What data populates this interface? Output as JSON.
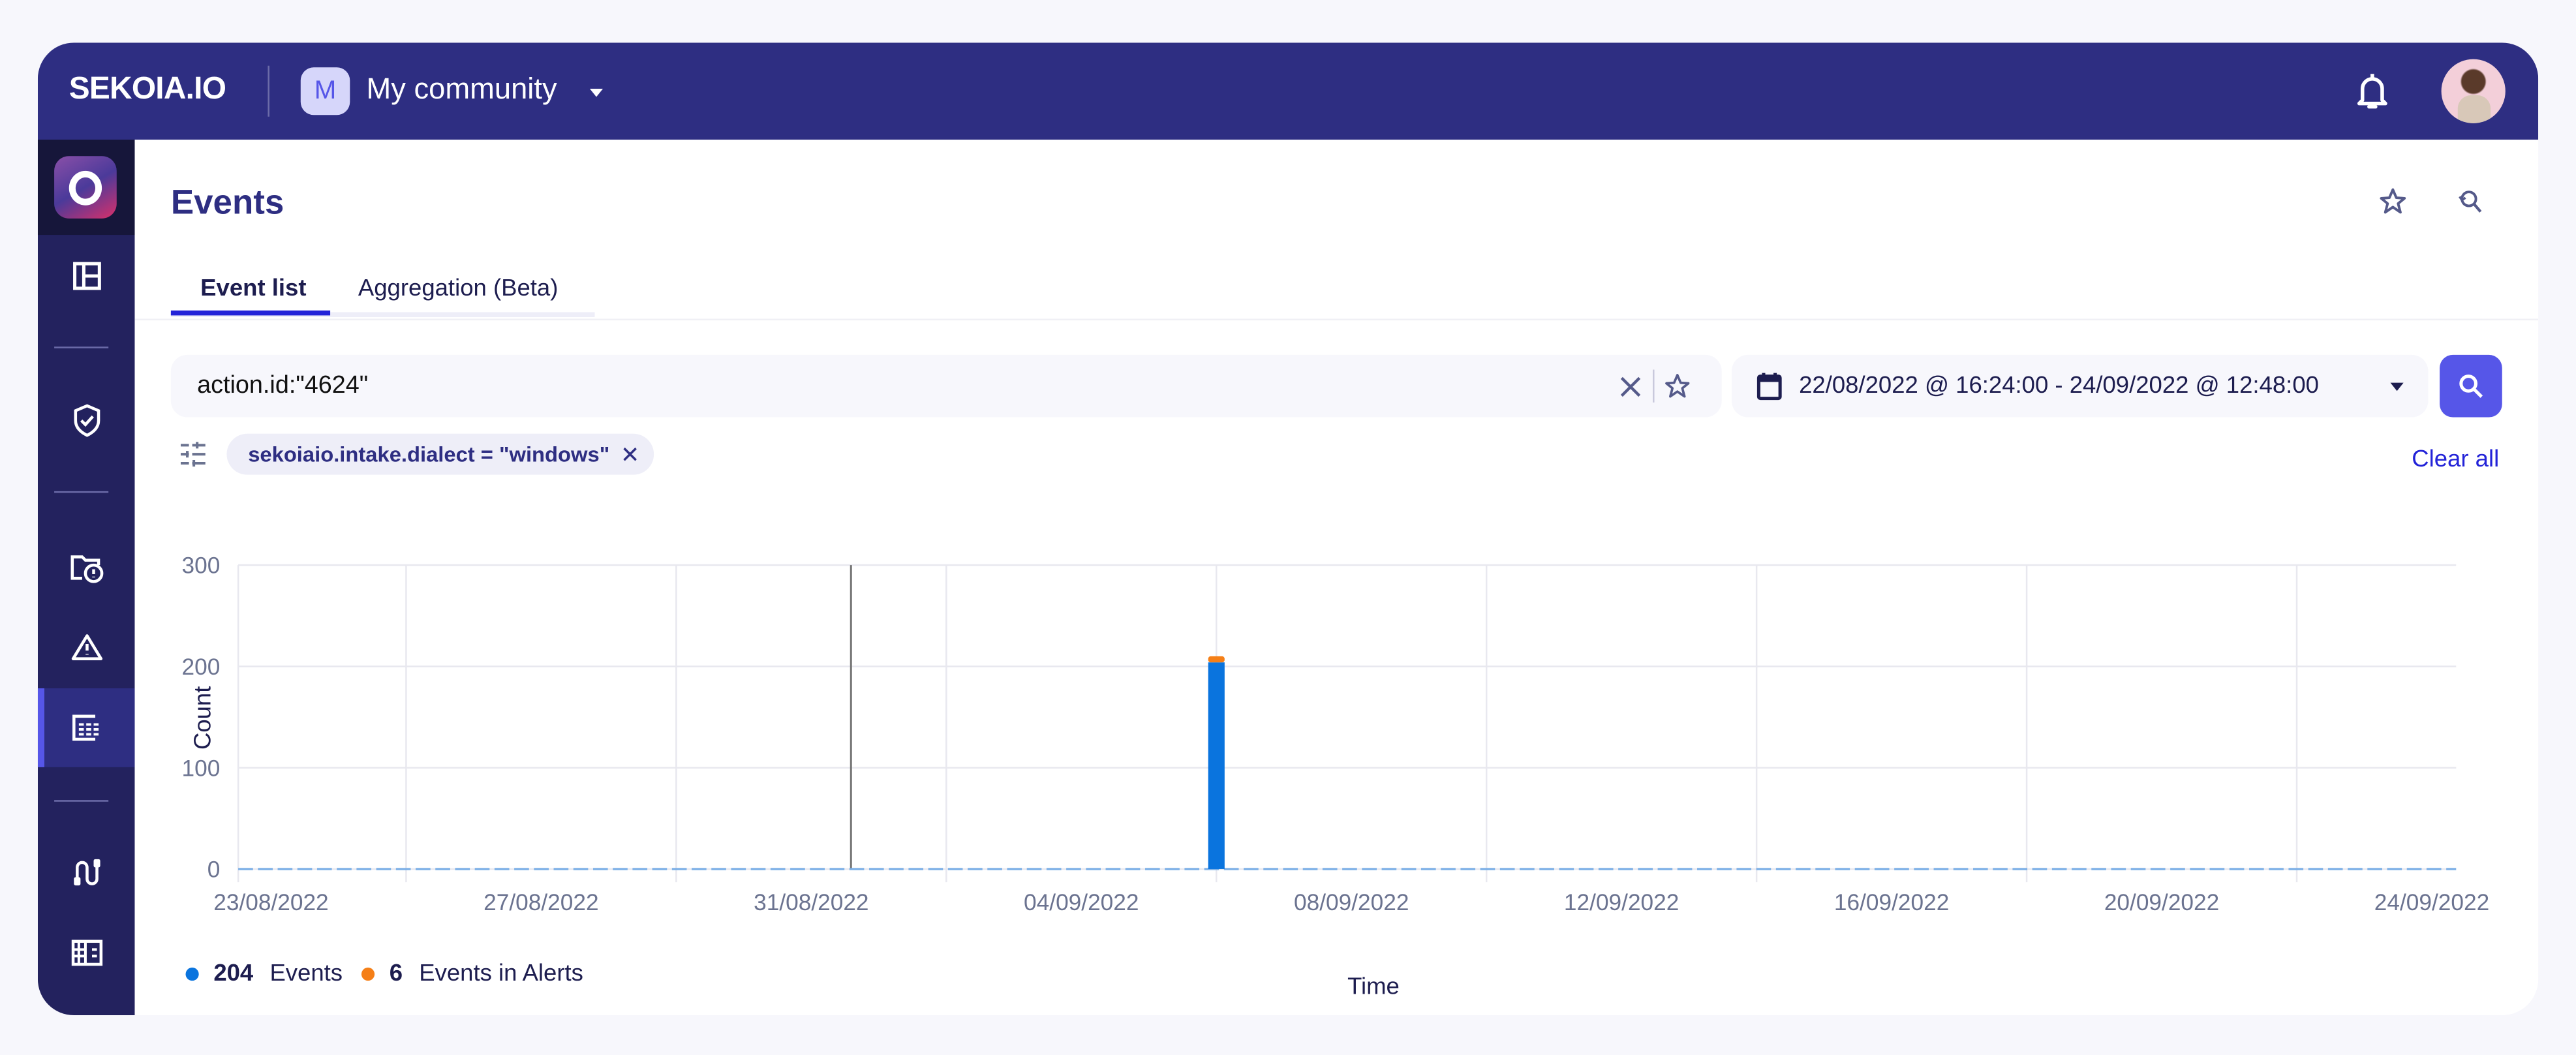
{
  "topbar": {
    "brand": "SEKOIA.IO",
    "community_initial": "M",
    "community_name": "My community"
  },
  "sidebar": {
    "items": [
      {
        "icon": "dashboard-icon"
      },
      {
        "icon": "shield-check-icon"
      },
      {
        "icon": "folder-alert-icon"
      },
      {
        "icon": "warning-icon"
      },
      {
        "icon": "events-icon",
        "active": true
      },
      {
        "icon": "intake-icon"
      },
      {
        "icon": "assets-icon"
      }
    ]
  },
  "page": {
    "title": "Events"
  },
  "tabs": [
    {
      "label": "Event list",
      "active": true
    },
    {
      "label": "Aggregation (Beta)",
      "active": false
    }
  ],
  "search": {
    "query": "action.id:\"4624\""
  },
  "date_range": {
    "value": "22/08/2022 @ 16:24:00 - 24/09/2022 @ 12:48:00"
  },
  "filters": {
    "chips": [
      {
        "label": "sekoiaio.intake.dialect = \"windows\""
      }
    ],
    "clear_all": "Clear all"
  },
  "colors": {
    "primary": "#2e2e82",
    "accent": "#5656e8",
    "events": "#0a74de",
    "alerts": "#f57f17"
  },
  "legend": [
    {
      "count": "204",
      "label": "Events"
    },
    {
      "count": "6",
      "label": "Events in Alerts"
    }
  ],
  "chart_data": {
    "type": "bar",
    "stacked": true,
    "xlabel": "Time",
    "ylabel": "Count",
    "ylim": [
      0,
      300
    ],
    "yticks": [
      0,
      100,
      200,
      300
    ],
    "xlim": [
      "22/08/2022 16:24",
      "24/09/2022 12:48"
    ],
    "xticks": [
      "23/08/2022",
      "27/08/2022",
      "31/08/2022",
      "04/09/2022",
      "08/09/2022",
      "12/09/2022",
      "16/09/2022",
      "20/09/2022",
      "24/09/2022"
    ],
    "grid": true,
    "legend_position": "bottom-left",
    "categories": [
      "06/09/2022"
    ],
    "series": [
      {
        "name": "Events",
        "values": [
          204
        ]
      },
      {
        "name": "Events in Alerts",
        "values": [
          6
        ]
      }
    ]
  }
}
